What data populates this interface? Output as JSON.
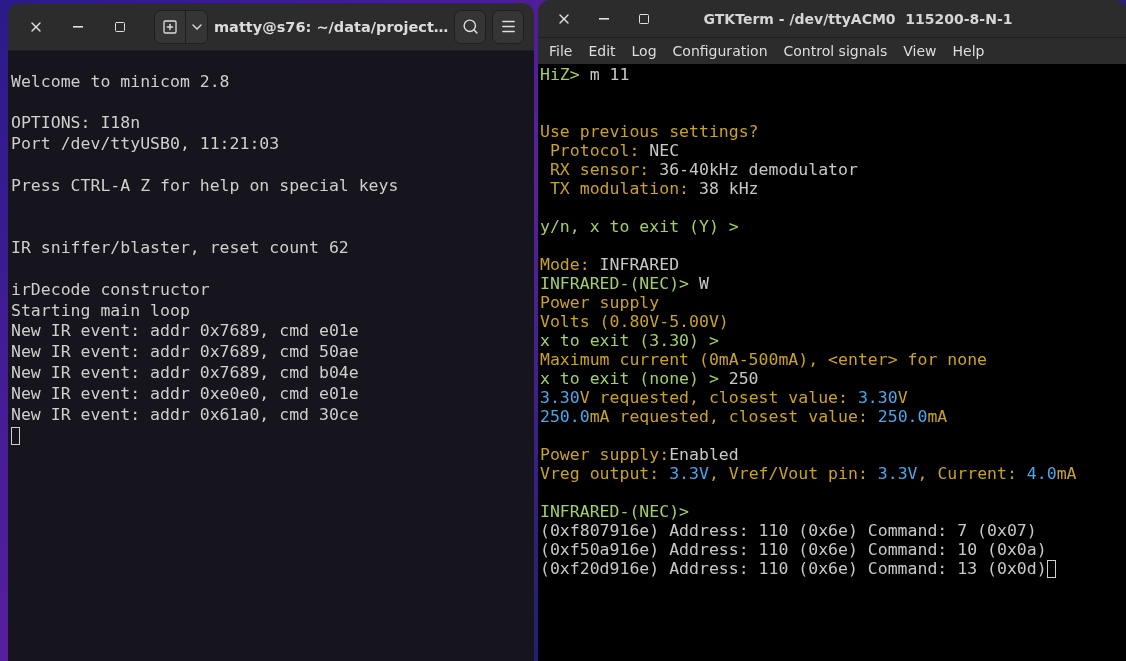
{
  "left_window": {
    "title": "matty@s76: ~/data/project…",
    "blocks": [
      {
        "kind": "paragraph",
        "lines": [
          {
            "text": "Welcome to minicom 2.8"
          }
        ]
      },
      {
        "kind": "paragraph",
        "lines": [
          {
            "text": "OPTIONS: I18n"
          },
          {
            "text": "Port /dev/ttyUSB0, 11:21:03"
          }
        ]
      },
      {
        "kind": "paragraph",
        "lines": [
          {
            "text": "Press CTRL-A Z for help on special keys"
          }
        ]
      },
      {
        "kind": "section",
        "lines": [
          {
            "text": "IR sniffer/blaster, reset count 62"
          }
        ]
      },
      {
        "kind": "paragraph",
        "lines": [
          {
            "text": "irDecode constructor"
          },
          {
            "text": "Starting main loop"
          },
          {
            "text": "New IR event: addr 0x7689, cmd e01e"
          },
          {
            "text": "New IR event: addr 0x7689, cmd 50ae"
          },
          {
            "text": "New IR event: addr 0x7689, cmd b04e"
          },
          {
            "text": "New IR event: addr 0xe0e0, cmd e01e"
          },
          {
            "text": "New IR event: addr 0x61a0, cmd 30ce"
          },
          {
            "cursor": true
          }
        ]
      }
    ]
  },
  "right_window": {
    "title": "GTKTerm - /dev/ttyACM0  115200-8-N-1",
    "menu": [
      "File",
      "Edit",
      "Log",
      "Configuration",
      "Control signals",
      "View",
      "Help"
    ],
    "blocks": [
      {
        "kind": "top",
        "lines": [
          {
            "segments": [
              {
                "kind": "prompt",
                "text": "HiZ>"
              },
              {
                "kind": "input",
                "text": " m 11"
              }
            ]
          }
        ]
      },
      {
        "kind": "section",
        "lines": [
          {
            "segments": [
              {
                "kind": "label",
                "text": "Use previous settings?"
              }
            ]
          },
          {
            "segments": [
              {
                "kind": "label",
                "text": " Protocol: "
              },
              {
                "kind": "input",
                "text": "NEC"
              }
            ]
          },
          {
            "segments": [
              {
                "kind": "label",
                "text": " RX sensor: "
              },
              {
                "kind": "input",
                "text": "36-40kHz demodulator"
              }
            ]
          },
          {
            "segments": [
              {
                "kind": "label",
                "text": " TX modulation: "
              },
              {
                "kind": "input",
                "text": "38 kHz"
              }
            ]
          }
        ]
      },
      {
        "kind": "paragraph",
        "lines": [
          {
            "segments": [
              {
                "kind": "prompt",
                "text": "y/n, x to exit (Y) >"
              }
            ]
          }
        ]
      },
      {
        "kind": "paragraph",
        "lines": [
          {
            "segments": [
              {
                "kind": "label",
                "text": "Mode: "
              },
              {
                "kind": "input",
                "text": "INFRARED"
              }
            ]
          },
          {
            "segments": [
              {
                "kind": "prompt",
                "text": "INFRARED-(NEC)>"
              },
              {
                "kind": "input",
                "text": " W"
              }
            ]
          },
          {
            "segments": [
              {
                "kind": "label",
                "text": "Power supply"
              }
            ]
          },
          {
            "segments": [
              {
                "kind": "label",
                "text": "Volts (0.80V-5.00V)"
              }
            ]
          },
          {
            "segments": [
              {
                "kind": "prompt",
                "text": "x to exit (3.30) >"
              }
            ]
          },
          {
            "segments": [
              {
                "kind": "label",
                "text": "Maximum current (0mA-500mA), <enter> for none"
              }
            ]
          },
          {
            "segments": [
              {
                "kind": "prompt",
                "text": "x to exit (none) >"
              },
              {
                "kind": "input",
                "text": " 250"
              }
            ]
          },
          {
            "segments": [
              {
                "kind": "value",
                "text": "3.30"
              },
              {
                "kind": "label",
                "text": "V requested, closest value: "
              },
              {
                "kind": "value",
                "text": "3.30"
              },
              {
                "kind": "label",
                "text": "V"
              }
            ]
          },
          {
            "segments": [
              {
                "kind": "value",
                "text": "250.0"
              },
              {
                "kind": "label",
                "text": "mA requested, closest value: "
              },
              {
                "kind": "value",
                "text": "250.0"
              },
              {
                "kind": "label",
                "text": "mA"
              }
            ]
          }
        ]
      },
      {
        "kind": "paragraph",
        "lines": [
          {
            "segments": [
              {
                "kind": "label",
                "text": "Power supply:"
              },
              {
                "kind": "input",
                "text": "Enabled"
              }
            ]
          },
          {
            "segments": [
              {
                "kind": "label",
                "text": "Vreg output: "
              },
              {
                "kind": "value",
                "text": "3.3V"
              },
              {
                "kind": "label",
                "text": ", Vref/Vout pin: "
              },
              {
                "kind": "value",
                "text": "3.3V"
              },
              {
                "kind": "label",
                "text": ", Current: "
              },
              {
                "kind": "value",
                "text": "4.0"
              },
              {
                "kind": "label",
                "text": "mA"
              }
            ]
          }
        ]
      },
      {
        "kind": "paragraph",
        "lines": [
          {
            "segments": [
              {
                "kind": "prompt",
                "text": "INFRARED-(NEC)>"
              }
            ]
          },
          {
            "segments": [
              {
                "kind": "input",
                "text": "(0xf807916e) Address: 110 (0x6e) Command: 7 (0x07)"
              }
            ]
          },
          {
            "segments": [
              {
                "kind": "input",
                "text": "(0xf50a916e) Address: 110 (0x6e) Command: 10 (0x0a)"
              }
            ]
          },
          {
            "cursor": true,
            "segments": [
              {
                "kind": "input",
                "text": "(0xf20d916e) Address: 110 (0x6e) Command: 13 (0x0d)"
              }
            ]
          }
        ]
      }
    ]
  }
}
